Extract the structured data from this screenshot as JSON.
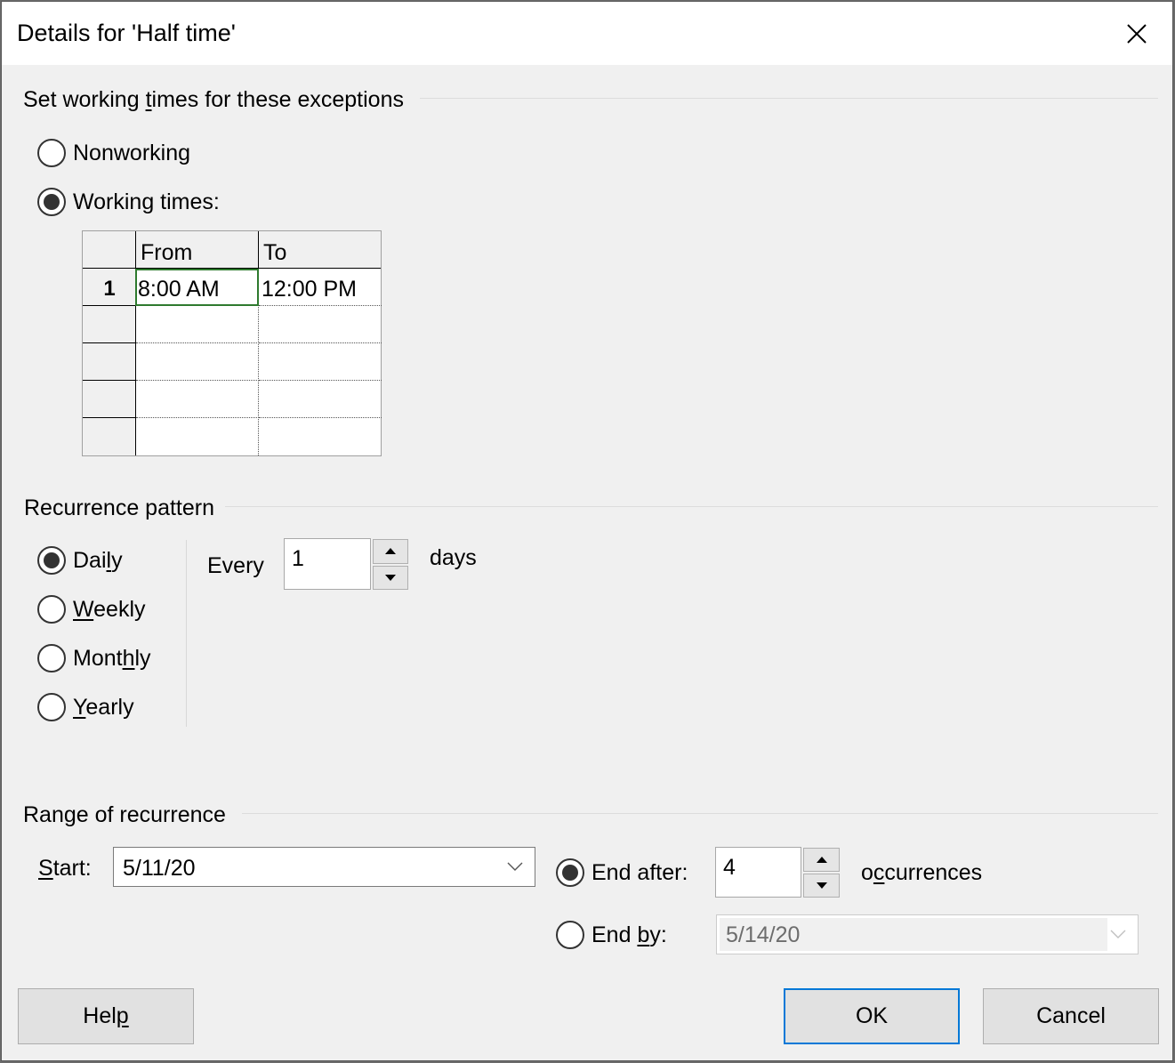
{
  "dialog": {
    "title": "Details for 'Half time'",
    "close_icon": "close-icon"
  },
  "working_times": {
    "group_label_pre": "Set working ",
    "group_label_accel": "t",
    "group_label_post": "imes for these exceptions",
    "options": [
      {
        "label": "Nonworking",
        "selected": false
      },
      {
        "label": "Working times:",
        "selected": true
      }
    ],
    "grid": {
      "columns": [
        "From",
        "To"
      ],
      "rows": [
        {
          "num": "1",
          "from": "8:00 AM",
          "to": "12:00 PM"
        },
        {
          "num": "",
          "from": "",
          "to": ""
        },
        {
          "num": "",
          "from": "",
          "to": ""
        },
        {
          "num": "",
          "from": "",
          "to": ""
        },
        {
          "num": "",
          "from": "",
          "to": ""
        }
      ],
      "active_cell": "row 1, From"
    }
  },
  "recurrence_pattern": {
    "group_label": "Recurrence pattern",
    "options": [
      {
        "pre": "Dai",
        "accel": "l",
        "post": "y",
        "selected": true
      },
      {
        "pre": "",
        "accel": "W",
        "post": "eekly",
        "selected": false
      },
      {
        "pre": "Mont",
        "accel": "h",
        "post": "ly",
        "selected": false
      },
      {
        "pre": "",
        "accel": "Y",
        "post": "early",
        "selected": false
      }
    ],
    "every_label": "Every",
    "every_value": "1",
    "unit_label": "days"
  },
  "range_of_recurrence": {
    "group_label": "Range of recurrence",
    "start_label_accel": "S",
    "start_label_post": "tart:",
    "start_value": "5/11/20",
    "end_after": {
      "label": "End after:",
      "selected": true,
      "value": "4"
    },
    "occurrences_pre": "o",
    "occurrences_accel": "c",
    "occurrences_post": "currences",
    "end_by": {
      "pre": "End ",
      "accel": "b",
      "post": "y:",
      "selected": false,
      "value": "5/14/20",
      "disabled": true
    }
  },
  "buttons": {
    "help_pre": "Hel",
    "help_accel": "p",
    "ok": "OK",
    "cancel": "Cancel"
  },
  "colors": {
    "default_button_border": "#0078d7",
    "active_cell_border": "#2e7a2e",
    "dialog_bg": "#f0f0f0"
  }
}
